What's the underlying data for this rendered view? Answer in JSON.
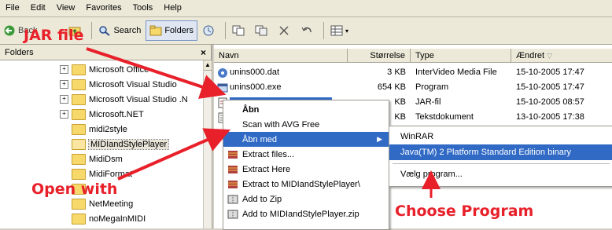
{
  "menubar": {
    "items": [
      "File",
      "Edit",
      "View",
      "Favorites",
      "Tools",
      "Help"
    ]
  },
  "toolbar": {
    "back_label": "Back",
    "search_label": "Search",
    "folders_label": "Folders"
  },
  "folders_pane": {
    "title": "Folders",
    "close_glyph": "×",
    "items": [
      {
        "label": "Microsoft Office",
        "expandable": true
      },
      {
        "label": "Microsoft Visual Studio",
        "expandable": true
      },
      {
        "label": "Microsoft Visual Studio .N",
        "expandable": true
      },
      {
        "label": "Microsoft.NET",
        "expandable": true
      },
      {
        "label": "midi2style",
        "expandable": false
      },
      {
        "label": "MIDIandStylePlayer",
        "expandable": false,
        "selected": true
      },
      {
        "label": "MidiDsm",
        "expandable": false
      },
      {
        "label": "MidiFormat",
        "expandable": false
      },
      {
        "label": "",
        "expandable": false
      },
      {
        "label": "NetMeeting",
        "expandable": false
      },
      {
        "label": "noMegaInMIDI",
        "expandable": false
      }
    ]
  },
  "file_list": {
    "columns": {
      "name": "Navn",
      "size": "Størrelse",
      "type": "Type",
      "modified": "Ændret"
    },
    "rows": [
      {
        "name": "unins000.dat",
        "size": "3 KB",
        "type": "InterVideo Media File",
        "modified": "15-10-2005 17:47"
      },
      {
        "name": "unins000.exe",
        "size": "654 KB",
        "type": "Program",
        "modified": "15-10-2005 17:47"
      },
      {
        "name": "",
        "size": "KB",
        "type": "JAR-fil",
        "modified": "15-10-2005 08:57"
      },
      {
        "name": "",
        "size": "KB",
        "type": "Tekstdokument",
        "modified": "13-10-2005 17:38"
      }
    ]
  },
  "context_menu": {
    "items": [
      {
        "label": "Åbn",
        "bold": true
      },
      {
        "label": "Scan with AVG Free"
      },
      {
        "label": "Åbn med",
        "submenu": true,
        "highlighted": true
      },
      {
        "label": "Extract files..."
      },
      {
        "label": "Extract Here"
      },
      {
        "label": "Extract to MIDIandStylePlayer\\"
      },
      {
        "label": "Add to Zip"
      },
      {
        "label": "Add to MIDIandStylePlayer.zip"
      }
    ]
  },
  "submenu": {
    "items": [
      {
        "label": "WinRAR"
      },
      {
        "label": "Java(TM) 2 Platform Standard Edition binary",
        "highlighted": true
      },
      {
        "label": "Vælg program..."
      }
    ]
  },
  "annotations": {
    "jar_file": "JAR file",
    "open_with": "Open with",
    "choose_program": "Choose Program",
    "color": "#e8202a"
  },
  "colors": {
    "highlight": "#316ac5",
    "annotation": "#e8202a"
  }
}
